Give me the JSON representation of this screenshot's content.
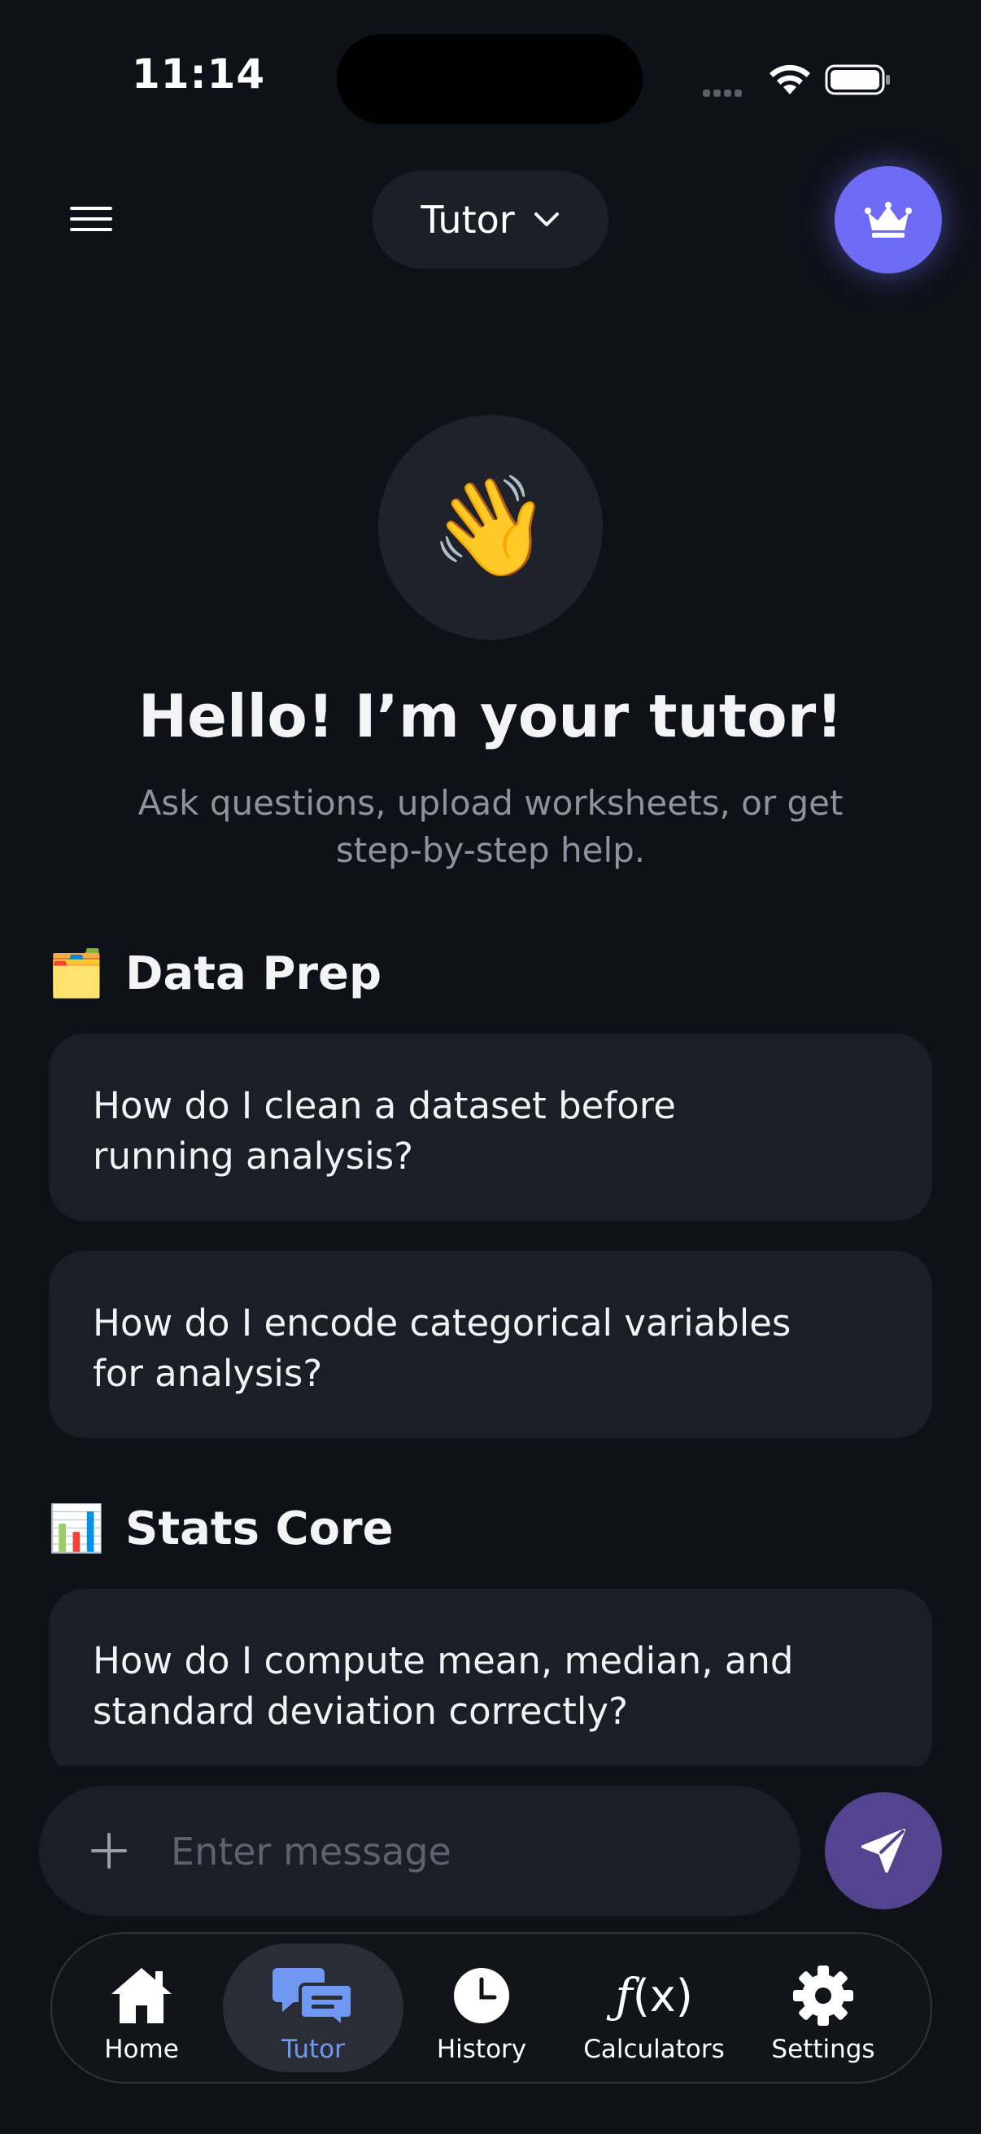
{
  "status_bar": {
    "time": "11:14"
  },
  "header": {
    "mode_label": "Tutor",
    "premium_icon": "crown-icon",
    "menu_icon": "hamburger-menu-icon"
  },
  "hero": {
    "emoji": "👋",
    "title": "Hello! I’m your tutor!",
    "subtitle": "Ask questions, upload worksheets, or get step-by-step help."
  },
  "sections": [
    {
      "emoji": "🗂️",
      "title": "Data Prep",
      "prompts": [
        "How do I clean a dataset before running analysis?",
        "How do I encode categorical variables for analysis?"
      ]
    },
    {
      "emoji": "📊",
      "title": "Stats Core",
      "prompts": [
        "How do I compute mean, median, and standard deviation correctly?"
      ]
    }
  ],
  "composer": {
    "placeholder": "Enter message",
    "send_icon": "paper-plane-icon",
    "attach_icon": "plus-icon"
  },
  "tabs": [
    {
      "label": "Home",
      "icon": "home-icon",
      "active": false
    },
    {
      "label": "Tutor",
      "icon": "chat-bubbles-icon",
      "active": true
    },
    {
      "label": "History",
      "icon": "clock-icon",
      "active": false
    },
    {
      "label": "Calculators",
      "icon": "function-icon",
      "active": false
    },
    {
      "label": "Settings",
      "icon": "gear-icon",
      "active": false
    }
  ],
  "colors": {
    "background": "#0e1118",
    "card": "#1b1e27",
    "accent": "#6e6cf6",
    "send_button": "#54448f",
    "active_tab_label": "#6f98f2"
  }
}
